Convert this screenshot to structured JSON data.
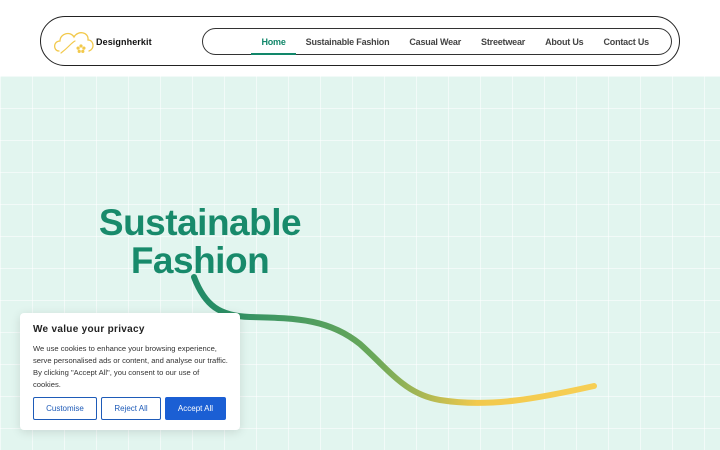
{
  "brand": {
    "name": "Designherkit"
  },
  "nav": {
    "items": [
      {
        "label": "Home",
        "active": true
      },
      {
        "label": "Sustainable Fashion",
        "active": false
      },
      {
        "label": "Casual Wear",
        "active": false
      },
      {
        "label": "Streetwear",
        "active": false
      },
      {
        "label": "About Us",
        "active": false
      },
      {
        "label": "Contact Us",
        "active": false
      }
    ]
  },
  "hero": {
    "title_line1": "Sustainable",
    "title_line2": "Fashion"
  },
  "cookie": {
    "title": "We value your privacy",
    "text": "We use cookies to enhance your browsing experience, serve personalised ads or content, and analyse our traffic. By clicking \"Accept All\", you consent to our use of cookies.",
    "customise_label": "Customise",
    "reject_label": "Reject All",
    "accept_label": "Accept All"
  },
  "colors": {
    "accent": "#188a6b",
    "hero_bg": "#e2f5ef",
    "wave_start": "#1f8a68",
    "wave_end": "#f7cf55",
    "button_blue": "#1b5fd4"
  }
}
